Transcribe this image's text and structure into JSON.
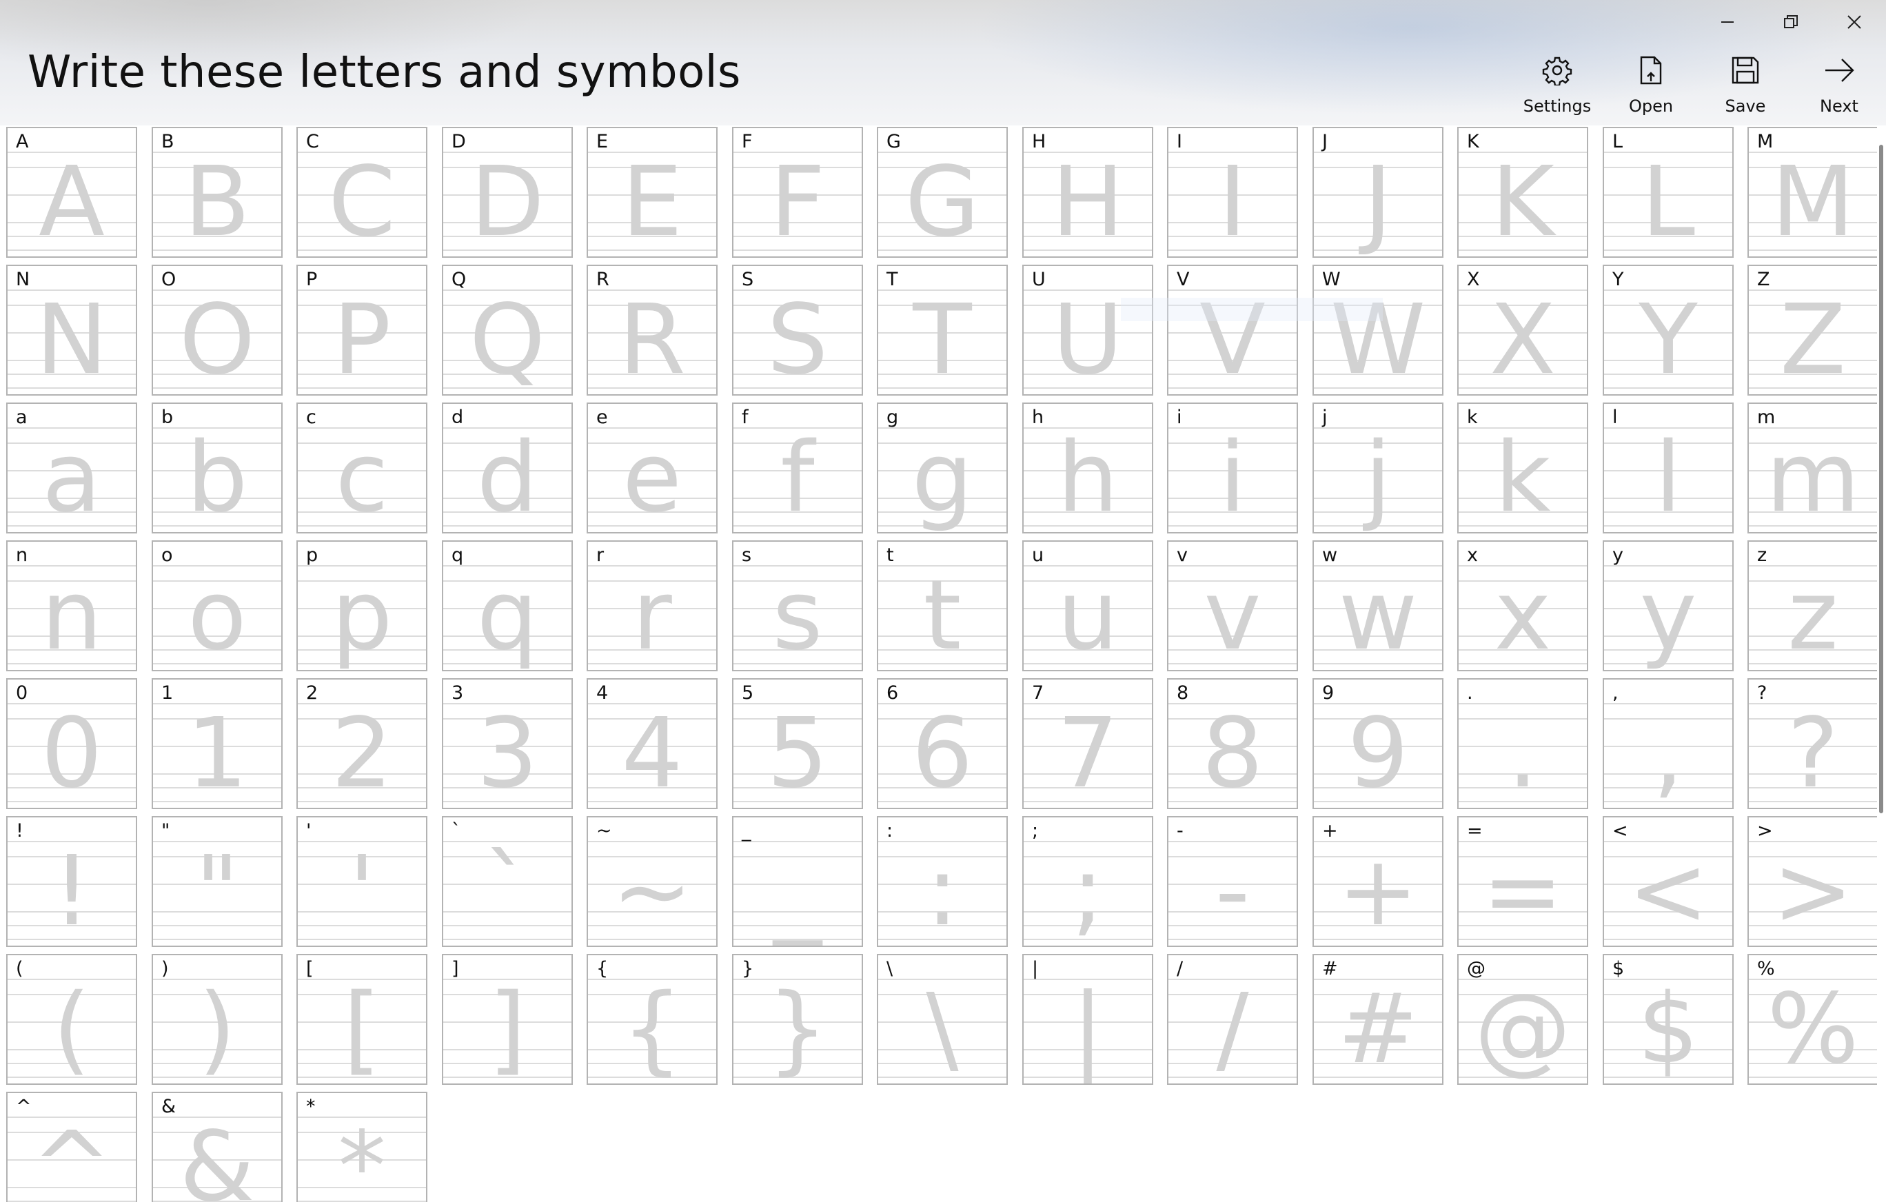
{
  "header": {
    "title": "Write these letters and symbols"
  },
  "window_controls": {
    "minimize": "minimize-icon",
    "restore": "restore-icon",
    "close": "close-icon"
  },
  "toolbar": {
    "settings_label": "Settings",
    "open_label": "Open",
    "save_label": "Save",
    "next_label": "Next"
  },
  "characters": [
    "A",
    "B",
    "C",
    "D",
    "E",
    "F",
    "G",
    "H",
    "I",
    "J",
    "K",
    "L",
    "M",
    "N",
    "O",
    "P",
    "Q",
    "R",
    "S",
    "T",
    "U",
    "V",
    "W",
    "X",
    "Y",
    "Z",
    "a",
    "b",
    "c",
    "d",
    "e",
    "f",
    "g",
    "h",
    "i",
    "j",
    "k",
    "l",
    "m",
    "n",
    "o",
    "p",
    "q",
    "r",
    "s",
    "t",
    "u",
    "v",
    "w",
    "x",
    "y",
    "z",
    "0",
    "1",
    "2",
    "3",
    "4",
    "5",
    "6",
    "7",
    "8",
    "9",
    ".",
    ",",
    "?",
    "!",
    "\"",
    "'",
    "`",
    "~",
    "_",
    ":",
    ";",
    "-",
    "+",
    "=",
    "<",
    ">",
    "(",
    ")",
    "[",
    "]",
    "{",
    "}",
    "\\",
    "|",
    "/",
    "#",
    "@",
    "$",
    "%",
    "^",
    "&",
    "*"
  ],
  "colors": {
    "cell_border": "#b3b3b3",
    "guide_glyph": "#d2d2d2",
    "guide_line": "#dcdcdc",
    "text": "#111111"
  }
}
